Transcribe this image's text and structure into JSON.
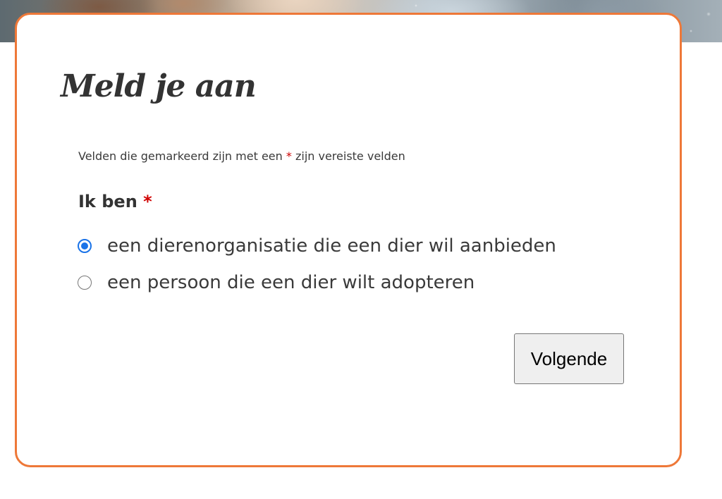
{
  "form": {
    "title": "Meld je aan",
    "required_note_prefix": "Velden die gemarkeerd zijn met een",
    "required_marker": "*",
    "required_note_suffix": "zijn vereiste velden",
    "field_label": "Ik ben",
    "options": [
      {
        "label": "een dierenorganisatie die een dier wil aanbieden",
        "selected": true
      },
      {
        "label": "een persoon die een dier wilt adopteren",
        "selected": false
      }
    ],
    "next_label": "Volgende"
  },
  "colors": {
    "accent_border": "#ee7838",
    "required_star": "#cc0000",
    "radio_selected": "#1a73e8"
  }
}
